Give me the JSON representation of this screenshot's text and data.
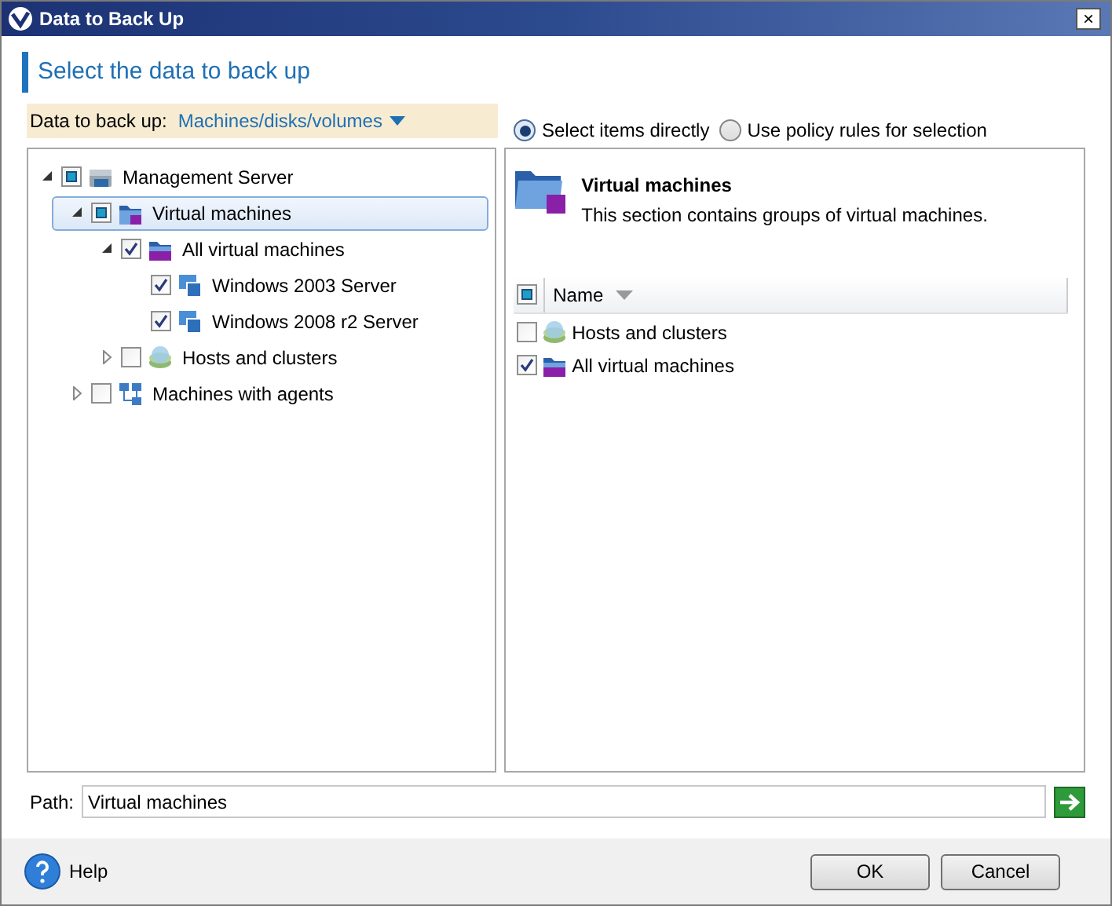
{
  "window": {
    "title": "Data to Back Up",
    "close": "×"
  },
  "heading": "Select the data to back up",
  "data_selector": {
    "label": "Data to back up:",
    "value": "Machines/disks/volumes"
  },
  "selection_mode": [
    {
      "label": "Select items directly",
      "selected": true
    },
    {
      "label": "Use policy rules for selection",
      "selected": false
    }
  ],
  "tree": [
    {
      "label": "Management Server",
      "kind": "server",
      "indeterminate": true,
      "expanded": true,
      "selected": false,
      "children": [
        {
          "label": "Virtual machines",
          "kind": "vmfolder",
          "indeterminate": true,
          "expanded": true,
          "selected": true,
          "children": [
            {
              "label": "All virtual machines",
              "kind": "vmall",
              "checked": true,
              "expanded": true,
              "selected": false,
              "children": [
                {
                  "label": "Windows 2003 Server",
                  "kind": "vm",
                  "checked": true,
                  "selected": false
                },
                {
                  "label": "Windows 2008 r2 Server",
                  "kind": "vm",
                  "checked": true,
                  "selected": false
                }
              ]
            },
            {
              "label": "Hosts and clusters",
              "kind": "hosts",
              "checked": false,
              "expanded": false,
              "selected": false
            }
          ]
        },
        {
          "label": "Machines with agents",
          "kind": "agents",
          "checked": false,
          "expanded": false,
          "selected": false
        }
      ]
    }
  ],
  "details": {
    "title": "Virtual machines",
    "description": "This section contains groups of virtual machines.",
    "list": {
      "header_indeterminate": true,
      "column": "Name",
      "rows": [
        {
          "label": "Hosts and clusters",
          "kind": "hosts",
          "checked": false
        },
        {
          "label": "All virtual machines",
          "kind": "vmall",
          "checked": true
        }
      ]
    }
  },
  "path": {
    "label": "Path:",
    "value": "Virtual machines"
  },
  "footer": {
    "help": "Help",
    "buttons": [
      "OK",
      "Cancel"
    ]
  }
}
